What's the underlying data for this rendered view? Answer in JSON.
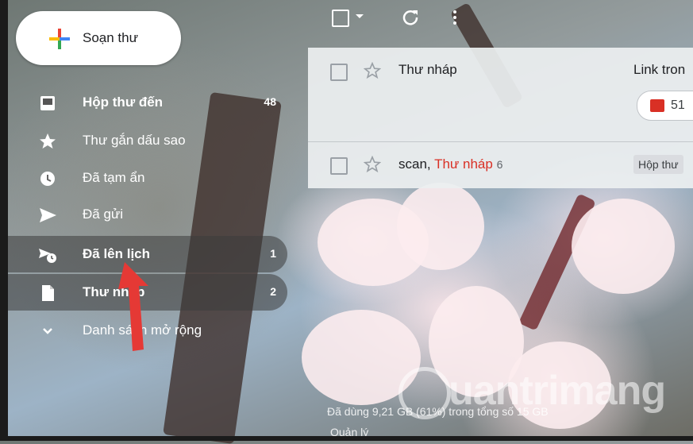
{
  "compose": {
    "label": "Soạn thư"
  },
  "nav": [
    {
      "label": "Hộp thư đến",
      "count": "48",
      "icon": "inbox-icon",
      "bold": true
    },
    {
      "label": "Thư gắn dấu sao",
      "count": "",
      "icon": "star-icon"
    },
    {
      "label": "Đã tạm ẩn",
      "count": "",
      "icon": "clock-icon"
    },
    {
      "label": "Đã gửi",
      "count": "",
      "icon": "send-icon"
    },
    {
      "label": "Đã lên lịch",
      "count": "1",
      "icon": "scheduled-icon",
      "bold": true
    },
    {
      "label": "Thư nháp",
      "count": "2",
      "icon": "draft-icon",
      "bold": true
    },
    {
      "label": "Danh sách mở rộng",
      "count": "",
      "icon": "chevron-down-icon"
    }
  ],
  "mails": [
    {
      "sender_red": "Thư nháp",
      "sender_extra": "",
      "count": "",
      "subject": "Link tron",
      "attachment": "51"
    },
    {
      "sender_prefix": "scan, ",
      "sender_red": "Thư nháp",
      "count": "6",
      "subject": "",
      "label": "Hộp thư"
    }
  ],
  "footer": {
    "storage": "Đã dùng 9,21 GB (61%) trong tổng số 15 GB",
    "manage": "Quản lý"
  },
  "watermark": "uantrimang",
  "colors": {
    "draft_red": "#d93025",
    "accent": "#e53935"
  }
}
